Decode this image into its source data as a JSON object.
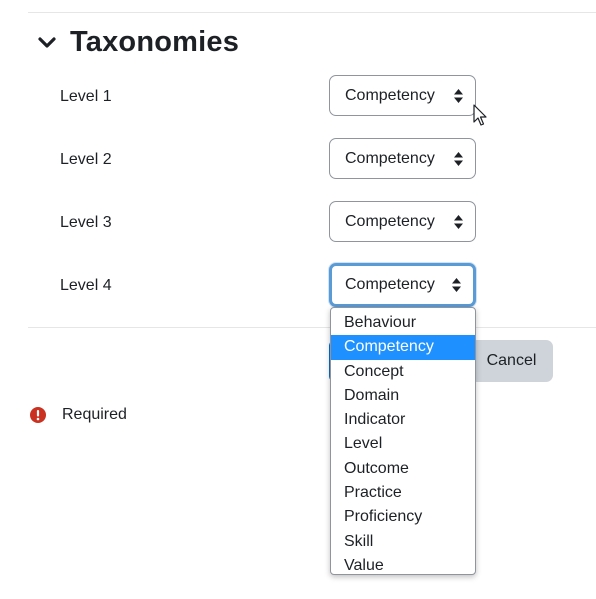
{
  "section": {
    "title": "Taxonomies",
    "collapse_icon": "chevron-down-icon"
  },
  "levels": [
    {
      "label": "Level 1",
      "value": "Competency"
    },
    {
      "label": "Level 2",
      "value": "Competency"
    },
    {
      "label": "Level 3",
      "value": "Competency"
    },
    {
      "label": "Level 4",
      "value": "Competency"
    }
  ],
  "dropdown": {
    "options": [
      "Behaviour",
      "Competency",
      "Concept",
      "Domain",
      "Indicator",
      "Level",
      "Outcome",
      "Practice",
      "Proficiency",
      "Skill",
      "Value"
    ],
    "selected_index": 1,
    "highlight_color": "#1e90ff"
  },
  "buttons": {
    "cancel_label": "Cancel",
    "primary_color": "#0f6cbf",
    "secondary_color": "#ced4da"
  },
  "required": {
    "icon": "exclamation-circle-icon",
    "label": "Required",
    "color": "#ca3120"
  },
  "focus_color": "#5b9bd5"
}
